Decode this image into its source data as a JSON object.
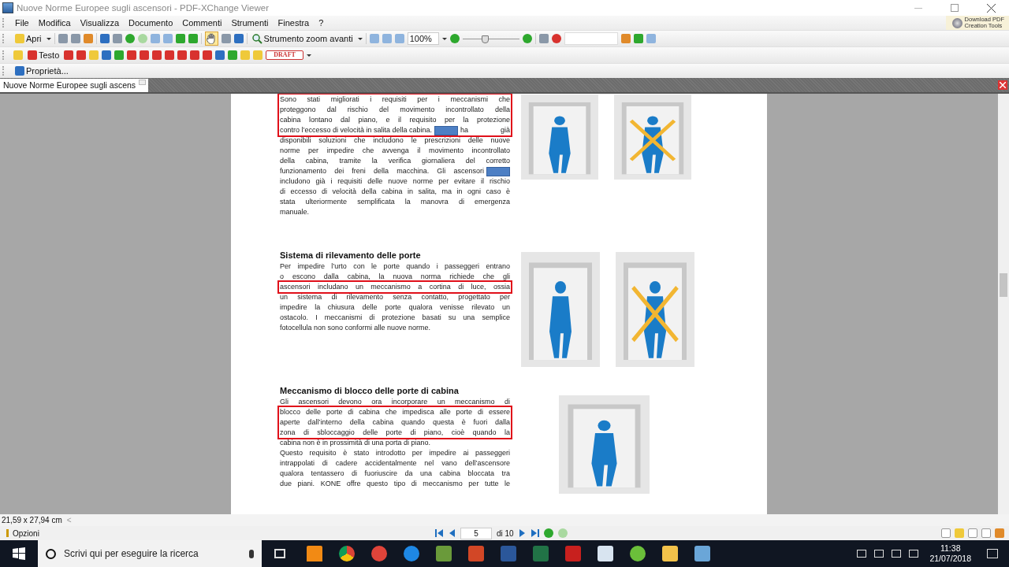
{
  "window": {
    "title": "Nuove Norme Europee sugli ascensori - PDF-XChange Viewer"
  },
  "menu": [
    "File",
    "Modifica",
    "Visualizza",
    "Documento",
    "Commenti",
    "Strumenti",
    "Finestra",
    "?"
  ],
  "download_button": {
    "line1": "Download PDF",
    "line2": "Creation Tools"
  },
  "toolbar": {
    "open_label": "Apri",
    "hand_tool_selected": true,
    "zoom_tool_label": "Strumento zoom avanti",
    "zoom_value": "100%",
    "zoom_slider": {
      "level": 0.4
    }
  },
  "comment_toolbar": {
    "text_tool_label": "Testo",
    "stamp_label": "DRAFT"
  },
  "properties_label": "Proprietà...",
  "tabs": [
    {
      "label": "Nuove Norme Europee sugli ascens",
      "selected": true
    }
  ],
  "document": {
    "sections": [
      {
        "blocks": [
          {
            "highlighted": true,
            "lines": [
              {
                "text": "Sono stati migliorati i requisiti per i meccanismi che"
              },
              {
                "text": "proteggono dal rischio del movimento incontrollato della"
              },
              {
                "text": "cabina lontano dal piano, e il requisito per la protezione"
              },
              {
                "text": "contro l’eccesso di velocità in salita della cabina.",
                "redacted": true,
                "after": "ha già"
              }
            ]
          },
          {
            "highlighted": false,
            "lines": [
              {
                "text": "disponibili soluzioni che includono le prescrizioni delle nuove"
              },
              {
                "text": "norme per impedire che avvenga il movimento incontrollato"
              },
              {
                "text": "della cabina, tramite la verifica giornaliera del corretto"
              },
              {
                "text": "funzionamento dei freni della macchina. Gli ascensori",
                "redacted": true
              },
              {
                "text": "includono già i requisiti delle nuove norme per evitare il rischio"
              },
              {
                "text": "di eccesso di velocità della cabina in salita, ma in ogni caso è"
              },
              {
                "text": "stata ulteriormente semplificata la manovra di emergenza"
              },
              {
                "text": "manuale."
              }
            ]
          }
        ],
        "illustrations": [
          {
            "crossed": false
          },
          {
            "crossed": true
          }
        ]
      },
      {
        "heading": "Sistema di rilevamento delle porte",
        "blocks": [
          {
            "highlighted": false,
            "lines": [
              {
                "text": "Per impedire l’urto con le porte quando i passeggeri entrano"
              },
              {
                "text": "o escono dalla cabina, la nuova norma richiede che gli"
              }
            ]
          },
          {
            "highlighted": true,
            "lines": [
              {
                "text": "ascensori includano un meccanismo a cortina di luce, ossia"
              }
            ]
          },
          {
            "highlighted": false,
            "lines": [
              {
                "text": "un sistema di rilevamento senza contatto, progettato per"
              },
              {
                "text": "impedire la chiusura delle porte qualora venisse rilevato un"
              },
              {
                "text": "ostacolo. I meccanismi di protezione basati su una semplice"
              },
              {
                "text": "fotocellula non sono conformi alle nuove norme.",
                "ends_paragraph": true
              }
            ]
          }
        ],
        "illustrations": [
          {
            "crossed": false
          },
          {
            "crossed": true
          }
        ]
      },
      {
        "heading": "Meccanismo di blocco delle porte di cabina",
        "blocks": [
          {
            "highlighted": false,
            "lines": [
              {
                "text": "Gli ascensori devono ora incorporare un meccanismo di"
              }
            ]
          },
          {
            "highlighted": true,
            "lines": [
              {
                "text": "blocco delle porte di cabina che impedisca alle porte di essere"
              },
              {
                "text": "aperte dall’interno della cabina quando questa è fuori dalla"
              },
              {
                "text": "zona di sbloccaggio delle porte di piano, cioè quando la"
              }
            ]
          },
          {
            "highlighted": false,
            "lines": [
              {
                "text": "cabina non è in prossimità di una porta di piano.",
                "ends_paragraph": true
              },
              {
                "text": "Questo requisito è stato introdotto per impedire ai passeggeri"
              },
              {
                "text": "intrappolati di cadere accidentalmente nel vano dell’ascensore"
              },
              {
                "text": "qualora tentassero di fuoriuscire da una cabina bloccata tra"
              },
              {
                "text": "due piani. KONE offre questo tipo di meccanismo per tutte le"
              }
            ]
          }
        ],
        "illustrations": [
          {
            "crossed": false
          }
        ]
      }
    ]
  },
  "status_bar": {
    "page_size": "21,59 x 27,94 cm",
    "scroll_arrow": "<"
  },
  "navigation": {
    "options_label": "Opzioni",
    "page": "5",
    "page_total": "di 10"
  },
  "taskbar": {
    "search_placeholder": "Scrivi qui per eseguire la ricerca",
    "time": "11:38",
    "date": "21/07/2018"
  }
}
